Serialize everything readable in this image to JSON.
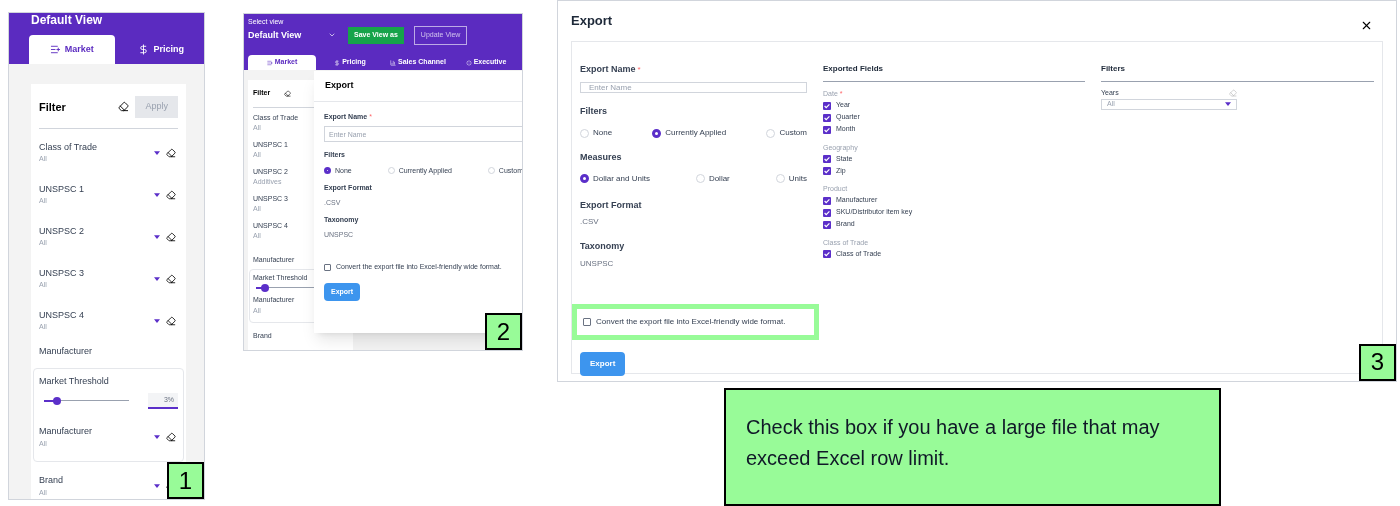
{
  "panel_1": {
    "header_title": "Default View",
    "tabs": [
      {
        "label": "Market",
        "selected": true
      },
      {
        "label": "Pricing",
        "selected": false
      }
    ],
    "filter_title": "Filter",
    "apply_button": {
      "label": "Apply",
      "disabled": true
    },
    "filters": [
      {
        "kind": "dropdown",
        "label": "Class of Trade",
        "value": "All"
      },
      {
        "kind": "dropdown",
        "label": "UNSPSC 1",
        "value": "All"
      },
      {
        "kind": "dropdown",
        "label": "UNSPSC 2",
        "value": "All"
      },
      {
        "kind": "dropdown",
        "label": "UNSPSC 3",
        "value": "All"
      },
      {
        "kind": "dropdown",
        "label": "UNSPSC 4",
        "value": "All"
      },
      {
        "kind": "heading",
        "label": "Manufacturer"
      },
      {
        "kind": "threshold",
        "label": "Market Threshold",
        "level": 0.15,
        "reading": "3%",
        "filter": {
          "label": "Manufacturer",
          "value": "All"
        }
      },
      {
        "kind": "dropdown",
        "label": "Brand",
        "value": "All"
      }
    ],
    "badge": "1"
  },
  "panel_2": {
    "select_view_label": "Select view",
    "view_name": "Default View",
    "save_button": "Save View as",
    "update_button": {
      "label": "Update View",
      "disabled": true
    },
    "tabs": [
      {
        "label": "Market",
        "selected": true
      },
      {
        "label": "Pricing",
        "selected": false
      },
      {
        "label": "Sales Channel",
        "selected": false
      },
      {
        "label": "Executive",
        "selected": false
      }
    ],
    "filter_title": "Filter",
    "filters": [
      {
        "kind": "dropdown",
        "label": "Class of Trade",
        "value": "All"
      },
      {
        "kind": "dropdown",
        "label": "UNSPSC 1",
        "value": "All"
      },
      {
        "kind": "dropdown",
        "label": "UNSPSC 2",
        "value": "Additives"
      },
      {
        "kind": "dropdown",
        "label": "UNSPSC 3",
        "value": "All"
      },
      {
        "kind": "dropdown",
        "label": "UNSPSC 4",
        "value": "All"
      },
      {
        "kind": "heading",
        "label": "Manufacturer"
      },
      {
        "kind": "threshold",
        "label": "Market Threshold",
        "level": 0.15,
        "filter": {
          "label": "Manufacturer",
          "value": "All"
        }
      },
      {
        "kind": "dropdown",
        "label": "Brand"
      }
    ],
    "dialog": {
      "title": "Export",
      "name_label": "Export Name",
      "required_mark": "*",
      "name_placeholder": "Enter Name",
      "filters_label": "Filters",
      "filter_options": [
        {
          "label": "None",
          "selected": true
        },
        {
          "label": "Currently Applied",
          "selected": false
        },
        {
          "label": "Custom",
          "selected": false
        }
      ],
      "format_label": "Export Format",
      "format_value": ".CSV",
      "taxonomy_label": "Taxonomy",
      "taxonomy_value": "UNSPSC",
      "convert_option": {
        "label": "Convert the export file into Excel-friendly wide format.",
        "checked": false
      },
      "export_button": "Export"
    },
    "badge": "2"
  },
  "panel_3": {
    "dialog": {
      "title": "Export",
      "name_label": "Export Name",
      "required_mark": "*",
      "name_placeholder": "Enter Name",
      "filters_label": "Filters",
      "filter_options": [
        {
          "label": "None",
          "selected": false
        },
        {
          "label": "Currently Applied",
          "selected": true
        },
        {
          "label": "Custom",
          "selected": false
        }
      ],
      "measures_label": "Measures",
      "measure_options": [
        {
          "label": "Dollar and Units",
          "selected": true
        },
        {
          "label": "Dollar",
          "selected": false
        },
        {
          "label": "Units",
          "selected": false
        }
      ],
      "format_label": "Export Format",
      "format_value": ".CSV",
      "taxonomy_label": "Taxonomy",
      "taxonomy_value": "UNSPSC",
      "convert_option": {
        "label": "Convert the export file into Excel-friendly wide format.",
        "checked": false,
        "highlighted": true
      },
      "export_button": "Export",
      "exported_fields_title": "Exported Fields",
      "field_groups": [
        {
          "label": "Date",
          "required_mark": "*",
          "fields": [
            {
              "label": "Year",
              "checked": true
            },
            {
              "label": "Quarter",
              "checked": true
            },
            {
              "label": "Month",
              "checked": true
            }
          ]
        },
        {
          "label": "Geography",
          "fields": [
            {
              "label": "State",
              "checked": true
            },
            {
              "label": "Zip",
              "checked": true
            }
          ]
        },
        {
          "label": "Product",
          "fields": [
            {
              "label": "Manufacturer",
              "checked": true
            },
            {
              "label": "SKU/Distributor item key",
              "checked": true
            },
            {
              "label": "Brand",
              "checked": true
            }
          ]
        },
        {
          "label": "Class of Trade",
          "fields": [
            {
              "label": "Class of Trade",
              "checked": true
            }
          ]
        }
      ],
      "side_filters_title": "Filters",
      "years_label": "Years",
      "years_value": "All"
    },
    "badge": "3"
  },
  "callout": "Check this box if you have a large file that may exceed Excel row limit."
}
